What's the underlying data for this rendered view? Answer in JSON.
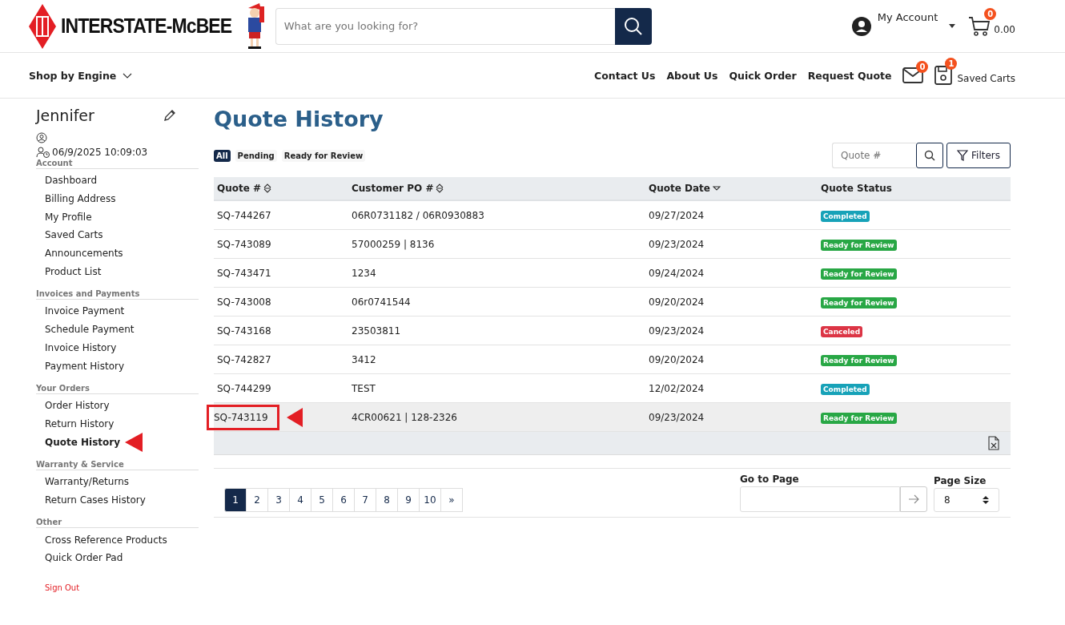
{
  "header": {
    "brand": "INTERSTATE-McBEE",
    "search": {
      "placeholder": "What are you looking for?"
    },
    "account": "My Account",
    "cart": {
      "count": "0",
      "total": "0.00"
    }
  },
  "nav": {
    "shop": "Shop by Engine",
    "links": [
      "Contact Us",
      "About Us",
      "Quick Order",
      "Request Quote"
    ],
    "messages_count": "0",
    "saved_carts": {
      "label": "Saved Carts",
      "count": "1"
    }
  },
  "sidebar": {
    "name": "Jennifer",
    "last_login": "06/9/2025 10:09:03",
    "sections": [
      {
        "title": "Account",
        "items": [
          {
            "label": "Dashboard",
            "selected": false,
            "marked": false
          },
          {
            "label": "Billing Address",
            "selected": false,
            "marked": false
          },
          {
            "label": "My Profile",
            "selected": false,
            "marked": false
          },
          {
            "label": "Saved Carts",
            "selected": false,
            "marked": false
          },
          {
            "label": "Announcements",
            "selected": false,
            "marked": false
          },
          {
            "label": "Product List",
            "selected": false,
            "marked": false
          }
        ]
      },
      {
        "title": "Invoices and Payments",
        "items": [
          {
            "label": "Invoice Payment",
            "selected": false,
            "marked": false
          },
          {
            "label": "Schedule Payment",
            "selected": false,
            "marked": false
          },
          {
            "label": "Invoice History",
            "selected": false,
            "marked": false
          },
          {
            "label": "Payment History",
            "selected": false,
            "marked": false
          }
        ]
      },
      {
        "title": "Your Orders",
        "items": [
          {
            "label": "Order History",
            "selected": false,
            "marked": false
          },
          {
            "label": "Return History",
            "selected": false,
            "marked": false
          },
          {
            "label": "Quote History",
            "selected": true,
            "marked": true
          }
        ]
      },
      {
        "title": "Warranty & Service",
        "items": [
          {
            "label": "Warranty/Returns",
            "selected": false,
            "marked": false
          },
          {
            "label": "Return Cases History",
            "selected": false,
            "marked": false
          }
        ]
      },
      {
        "title": "Other",
        "items": [
          {
            "label": "Cross Reference Products",
            "selected": false,
            "marked": false
          },
          {
            "label": "Quick Order Pad",
            "selected": false,
            "marked": false
          }
        ]
      }
    ],
    "sign_out": "Sign Out"
  },
  "main": {
    "title": "Quote History",
    "filter_tabs": [
      {
        "label": "All",
        "selected": true
      },
      {
        "label": "Pending",
        "selected": false
      },
      {
        "label": "Ready for Review",
        "selected": false
      }
    ],
    "quote_search": {
      "placeholder": "Quote #"
    },
    "filters_button": "Filters",
    "table": {
      "columns": [
        {
          "label": "Quote #",
          "sortable": true,
          "sorted_descending": false
        },
        {
          "label": "Customer PO #",
          "sortable": true,
          "sorted_descending": false
        },
        {
          "label": "Quote Date",
          "sortable": true,
          "sorted_descending": true
        },
        {
          "label": "Quote Status",
          "sortable": false
        }
      ],
      "rows": [
        {
          "quote": "SQ-744267",
          "po": "06R0731182 / 06R0930883",
          "date": "09/27/2024",
          "status": "Completed",
          "kind": "completed",
          "selected": false,
          "marked": false
        },
        {
          "quote": "SQ-743089",
          "po": "57000259 | 8136",
          "date": "09/23/2024",
          "status": "Ready for Review",
          "kind": "ready",
          "selected": false,
          "marked": false
        },
        {
          "quote": "SQ-743471",
          "po": "1234",
          "date": "09/24/2024",
          "status": "Ready for Review",
          "kind": "ready",
          "selected": false,
          "marked": false
        },
        {
          "quote": "SQ-743008",
          "po": "06r0741544",
          "date": "09/20/2024",
          "status": "Ready for Review",
          "kind": "ready",
          "selected": false,
          "marked": false
        },
        {
          "quote": "SQ-743168",
          "po": "23503811",
          "date": "09/23/2024",
          "status": "Canceled",
          "kind": "canceled",
          "selected": false,
          "marked": false
        },
        {
          "quote": "SQ-742827",
          "po": "3412",
          "date": "09/20/2024",
          "status": "Ready for Review",
          "kind": "ready",
          "selected": false,
          "marked": false
        },
        {
          "quote": "SQ-744299",
          "po": "TEST",
          "date": "12/02/2024",
          "status": "Completed",
          "kind": "completed",
          "selected": false,
          "marked": false
        },
        {
          "quote": "SQ-743119",
          "po": "4CR00621 | 128-2326",
          "date": "09/23/2024",
          "status": "Ready for Review",
          "kind": "ready",
          "selected": true,
          "marked": true
        }
      ]
    },
    "pagination": {
      "pages": [
        {
          "label": "1",
          "selected": true
        },
        {
          "label": "2",
          "selected": false
        },
        {
          "label": "3",
          "selected": false
        },
        {
          "label": "4",
          "selected": false
        },
        {
          "label": "5",
          "selected": false
        },
        {
          "label": "6",
          "selected": false
        },
        {
          "label": "7",
          "selected": false
        },
        {
          "label": "8",
          "selected": false
        },
        {
          "label": "9",
          "selected": false
        },
        {
          "label": "10",
          "selected": false
        },
        {
          "label": "»",
          "selected": false
        }
      ],
      "go_to_page": "Go to Page",
      "page_size_label": "Page Size",
      "page_size": "8"
    }
  }
}
